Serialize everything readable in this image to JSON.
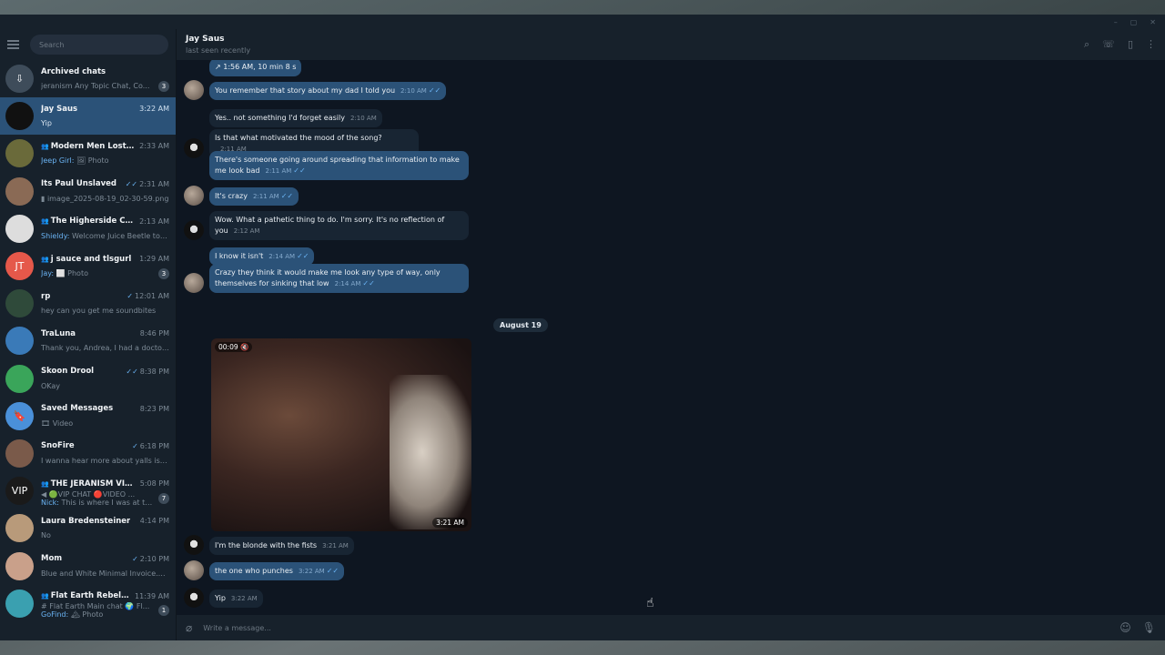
{
  "window": {
    "controls": [
      "–",
      "▢",
      "✕"
    ]
  },
  "search": {
    "placeholder": "Search"
  },
  "chats": [
    {
      "name": "Archived chats",
      "preview": "jeranism Any Topic Chat, Co...",
      "badge": "3",
      "avatar_color": "#3e4c5a",
      "avatar_text": "⇩"
    },
    {
      "name": "Jay Saus",
      "time": "3:22 AM",
      "preview": "Yip",
      "active": true,
      "avatar_color": "#111111"
    },
    {
      "name": "Modern Men Lost Ag...",
      "time": "2:33 AM",
      "preview_sender": "Jeep Girl:",
      "preview": "🖼 Photo",
      "group": true,
      "avatar_color": "#6a6a3a"
    },
    {
      "name": "Its Paul Unslaved",
      "time": "2:31 AM",
      "preview": "▮ image_2025-08-19_02-30-59.png",
      "ticks": "✓✓",
      "avatar_color": "#8a6a55"
    },
    {
      "name": "The Higherside Chat...",
      "time": "2:13 AM",
      "preview_sender": "Shieldy:",
      "preview": "Welcome Juice Beetle to T...",
      "group": true,
      "avatar_color": "#dddddd"
    },
    {
      "name": "j sauce and tlsgurl",
      "time": "1:29 AM",
      "preview_sender": "Jay:",
      "preview": "⬜ Photo",
      "badge": "3",
      "group": true,
      "avatar_color": "#e5584a",
      "avatar_text": "JT"
    },
    {
      "name": "rp",
      "time": "12:01 AM",
      "preview": "hey can you get me soundbites",
      "ticks": "✓",
      "avatar_color": "#2f4a3a"
    },
    {
      "name": "TraLuna",
      "time": "8:46 PM",
      "preview": "Thank you, Andrea, I had a doctor...",
      "avatar_color": "#3a7ab8"
    },
    {
      "name": "Skoon Drool",
      "time": "8:38 PM",
      "preview": "OKay",
      "ticks": "✓✓",
      "avatar_color": "#3aa55a"
    },
    {
      "name": "Saved Messages",
      "time": "8:23 PM",
      "preview": "🎞 Video",
      "avatar_color": "#4a90d9",
      "avatar_text": "🔖"
    },
    {
      "name": "SnoFire",
      "time": "6:18 PM",
      "preview": "I wanna hear more about yalls iss...",
      "ticks": "✓",
      "avatar_color": "#7a5a4a"
    },
    {
      "name": "THE JERANISM VIP C...",
      "time": "5:08 PM",
      "preview": "◀ 🟢VIP CHAT 🔴VIDEO ...",
      "preview2_sender": "Nick:",
      "preview2": "This is where I was at tod...",
      "badge": "7",
      "group": true,
      "avatar_color": "#1a1a1a",
      "avatar_text": "VIP"
    },
    {
      "name": "Laura Bredensteiner",
      "time": "4:14 PM",
      "preview": "No",
      "avatar_color": "#b89a7a"
    },
    {
      "name": "Mom",
      "time": "2:10 PM",
      "preview": "Blue and White Minimal Invoice.pdf",
      "ticks": "✓",
      "avatar_color": "#c9a08a"
    },
    {
      "name": "Flat Earth Rebellion",
      "time": "11:39 AM",
      "preview": "# Flat Earth Main chat 🌍 Fl...",
      "preview2_sender": "GoFind:",
      "preview2": "🏔 Photo",
      "badge": "1",
      "group": true,
      "avatar_color": "#3aa0b0"
    }
  ],
  "header": {
    "name": "Jay Saus",
    "status": "last seen recently"
  },
  "messages": [
    {
      "text": "↗ 1:56 AM, 10 min 8 s",
      "time": "",
      "dir": "out",
      "clip": true
    },
    {
      "text": "You remember that story about my dad I told you",
      "time": "2:10 AM",
      "dir": "out",
      "check": "✓✓"
    },
    {
      "text": "Yes.. not something I'd forget easily",
      "time": "2:10 AM",
      "dir": "in"
    },
    {
      "text": "Is that what motivated the mood of the song?",
      "time": "2:11 AM",
      "dir": "in"
    },
    {
      "text": "There's someone going around spreading that information to make me look bad",
      "time": "2:11 AM",
      "dir": "out",
      "check": "✓✓"
    },
    {
      "text": "It's crazy",
      "time": "2:11 AM",
      "dir": "out",
      "check": "✓✓"
    },
    {
      "text": "Wow. What a pathetic thing to do. I'm sorry. It's no reflection of you",
      "time": "2:12 AM",
      "dir": "in"
    },
    {
      "text": "I know it isn't",
      "time": "2:14 AM",
      "dir": "out",
      "check": "✓✓"
    },
    {
      "text": "Crazy they think it would make me look any type of way, only themselves for sinking that low",
      "time": "2:14 AM",
      "dir": "out",
      "check": "✓✓"
    },
    {
      "text": "I'm the blonde with the fists",
      "time": "3:21 AM",
      "dir": "in"
    },
    {
      "text": "the one who punches",
      "time": "3:22 AM",
      "dir": "out",
      "check": "✓✓"
    },
    {
      "text": "Yip",
      "time": "3:22 AM",
      "dir": "in"
    }
  ],
  "date_separator": "August 19",
  "video": {
    "duration": "00:09",
    "time": "3:21 AM",
    "muted_icon": "🔇"
  },
  "composer": {
    "placeholder": "Write a message..."
  }
}
